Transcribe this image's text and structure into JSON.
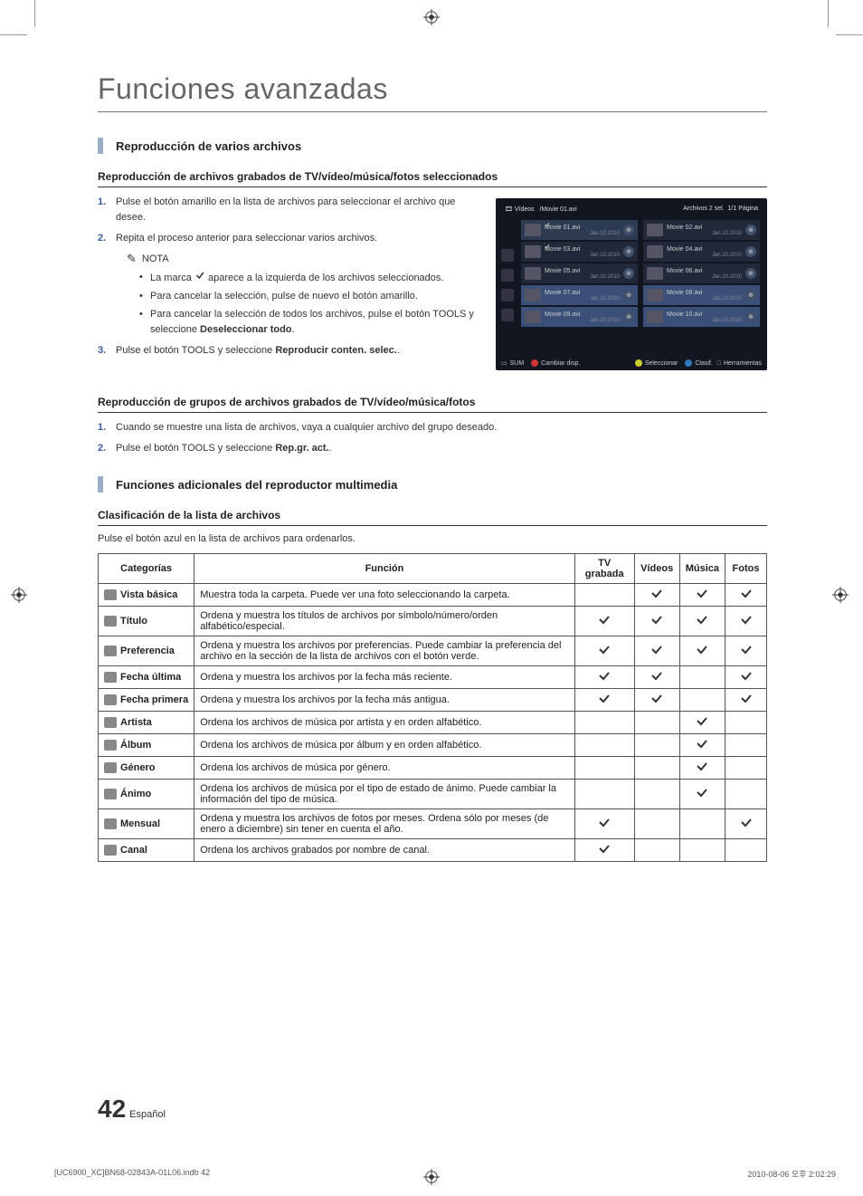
{
  "page": {
    "title": "Funciones avanzadas",
    "number": "42",
    "lang": "Español"
  },
  "footer": {
    "left": "[UC6900_XC]BN68-02843A-01L06.indb   42",
    "right": "2010-08-06   오후 2:02:29"
  },
  "sec1": {
    "heading": "Reproducción de varios archivos",
    "sub1": "Reproducción de archivos grabados de TV/vídeo/música/fotos seleccionados",
    "step1_num": "1.",
    "step1": "Pulse el botón amarillo en la lista de archivos para seleccionar el archivo que desee.",
    "step2_num": "2.",
    "step2": "Repita el proceso anterior para seleccionar varios archivos.",
    "note_label": "NOTA",
    "note_b1_a": "La marca ",
    "note_b1_b": " aparece a la izquierda de los archivos seleccionados.",
    "note_b2": "Para cancelar la selección, pulse de nuevo el botón amarillo.",
    "note_b3_a": "Para cancelar la selección de todos los archivos, pulse el botón ",
    "note_b3_tools": "TOOLS",
    "note_b3_b": " y seleccione ",
    "note_b3_strong": "Deseleccionar todo",
    "note_b3_c": ".",
    "step3_num": "3.",
    "step3_a": "Pulse el botón ",
    "step3_tools": "TOOLS",
    "step3_b": " y seleccione ",
    "step3_strong": "Reproducir conten. selec.",
    "step3_c": "."
  },
  "sec2": {
    "sub": "Reproducción de grupos de archivos grabados de TV/vídeo/música/fotos",
    "step1_num": "1.",
    "step1": "Cuando se muestre una lista de archivos, vaya a cualquier archivo del grupo deseado.",
    "step2_num": "2.",
    "step2_a": "Pulse el botón ",
    "step2_tools": "TOOLS",
    "step2_b": " y seleccione ",
    "step2_strong": "Rep.gr. act.",
    "step2_c": "."
  },
  "sec3": {
    "heading": "Funciones adicionales del reproductor multimedia",
    "sub": "Clasificación de la lista de archivos",
    "desc": "Pulse el botón azul en la lista de archivos para ordenarlos."
  },
  "table": {
    "headers": {
      "cat": "Categorías",
      "func": "Función",
      "tv": "TV grabada",
      "vid": "Vídeos",
      "mus": "Música",
      "fot": "Fotos"
    },
    "rows": [
      {
        "cat": "Vista básica",
        "func": "Muestra toda la carpeta. Puede ver una foto seleccionando la carpeta.",
        "tv": false,
        "vid": true,
        "mus": true,
        "fot": true
      },
      {
        "cat": "Título",
        "func": "Ordena y muestra los títulos de archivos por símbolo/número/orden alfabético/especial.",
        "tv": true,
        "vid": true,
        "mus": true,
        "fot": true
      },
      {
        "cat": "Preferencia",
        "func": "Ordena y muestra los archivos por preferencias. Puede cambiar la preferencia del archivo en la sección de la lista de archivos con el botón verde.",
        "tv": true,
        "vid": true,
        "mus": true,
        "fot": true
      },
      {
        "cat": "Fecha última",
        "func": "Ordena y muestra los archivos por la fecha más reciente.",
        "tv": true,
        "vid": true,
        "mus": false,
        "fot": true
      },
      {
        "cat": "Fecha primera",
        "func": "Ordena y muestra los archivos por la fecha más antigua.",
        "tv": true,
        "vid": true,
        "mus": false,
        "fot": true
      },
      {
        "cat": "Artista",
        "func": "Ordena los archivos de música por artista y en orden alfabético.",
        "tv": false,
        "vid": false,
        "mus": true,
        "fot": false
      },
      {
        "cat": "Álbum",
        "func": "Ordena los archivos de música por álbum y en orden alfabético.",
        "tv": false,
        "vid": false,
        "mus": true,
        "fot": false
      },
      {
        "cat": "Género",
        "func": "Ordena los archivos de música por género.",
        "tv": false,
        "vid": false,
        "mus": true,
        "fot": false
      },
      {
        "cat": "Ánimo",
        "func": "Ordena los archivos de música por el tipo de estado de ánimo. Puede cambiar la información del tipo de música.",
        "tv": false,
        "vid": false,
        "mus": true,
        "fot": false
      },
      {
        "cat": "Mensual",
        "func": "Ordena y muestra los archivos de fotos por meses. Ordena sólo por meses (de enero a diciembre) sin tener en cuenta el año.",
        "tv": true,
        "vid": false,
        "mus": false,
        "fot": true
      },
      {
        "cat": "Canal",
        "func": "Ordena los archivos grabados por nombre de canal.",
        "tv": true,
        "vid": false,
        "mus": false,
        "fot": false
      }
    ]
  },
  "screenshot": {
    "title_left": "Vídeos",
    "breadcrumb": "/Movie 01.avi",
    "sel_count": "Archivos 2 sel.",
    "page": "1/1 Página",
    "items": [
      {
        "name": "Movie 01.avi",
        "date": "Jan.10.2010",
        "sel": true,
        "checked": true
      },
      {
        "name": "Movie 02.avi",
        "date": "Jan.10.2010"
      },
      {
        "name": "Movie 03.avi",
        "date": "Jan.10.2010",
        "checked": true
      },
      {
        "name": "Movie 04.avi",
        "date": "Jan.10.2010"
      },
      {
        "name": "Movie 05.avi",
        "date": "Jan.10.2010"
      },
      {
        "name": "Movie 06.avi",
        "date": "Jan.10.2010"
      },
      {
        "name": "Movie 07.avi",
        "date": "Jan.10.2010",
        "hl": true
      },
      {
        "name": "Movie 08.avi",
        "date": "Jan.10.2010",
        "hl": true
      },
      {
        "name": "Movie 09.avi",
        "date": "Jan.10.2010",
        "hl": true
      },
      {
        "name": "Movie 10.avi",
        "date": "Jan.10.2010",
        "hl": true
      }
    ],
    "footer": {
      "sum": "SUM",
      "a": "Cambiar disp.",
      "c": "Seleccionar",
      "d": "Clasif.",
      "tools": "Herramientas"
    }
  }
}
